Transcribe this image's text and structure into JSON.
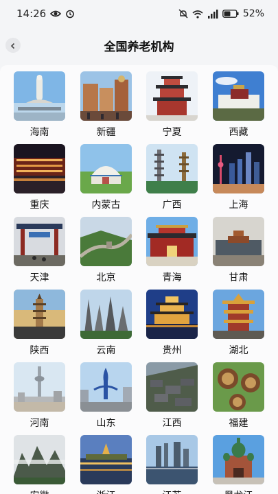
{
  "status": {
    "time": "14:26",
    "battery": "52%"
  },
  "header": {
    "title": "全国养老机构"
  },
  "provinces": [
    {
      "name": "海南",
      "thumb": "guanyin-statue-photo"
    },
    {
      "name": "新疆",
      "thumb": "bazaar-photo"
    },
    {
      "name": "宁夏",
      "thumb": "pagoda-tower-photo"
    },
    {
      "name": "西藏",
      "thumb": "potala-palace-photo"
    },
    {
      "name": "重庆",
      "thumb": "night-riverside-photo"
    },
    {
      "name": "内蒙古",
      "thumb": "yurt-grassland-photo"
    },
    {
      "name": "广西",
      "thumb": "twin-pagodas-photo"
    },
    {
      "name": "上海",
      "thumb": "pudong-skyline-photo"
    },
    {
      "name": "天津",
      "thumb": "ancient-street-gate-photo"
    },
    {
      "name": "北京",
      "thumb": "great-wall-photo"
    },
    {
      "name": "青海",
      "thumb": "temple-hall-photo"
    },
    {
      "name": "甘肃",
      "thumb": "city-aerial-photo"
    },
    {
      "name": "陕西",
      "thumb": "big-wild-goose-pagoda-photo"
    },
    {
      "name": "云南",
      "thumb": "stone-forest-photo"
    },
    {
      "name": "贵州",
      "thumb": "lit-pavilion-photo"
    },
    {
      "name": "湖北",
      "thumb": "yellow-crane-tower-photo"
    },
    {
      "name": "河南",
      "thumb": "tv-tower-photo"
    },
    {
      "name": "山东",
      "thumb": "fountain-sculpture-photo"
    },
    {
      "name": "江西",
      "thumb": "old-town-roofs-photo"
    },
    {
      "name": "福建",
      "thumb": "tulou-photo"
    },
    {
      "name": "安徽",
      "thumb": "huangshan-photo"
    },
    {
      "name": "浙江",
      "thumb": "west-lake-night-photo"
    },
    {
      "name": "江苏",
      "thumb": "lakeside-skyline-photo"
    },
    {
      "name": "黑龙江",
      "thumb": "st-sophia-cathedral-photo"
    }
  ]
}
